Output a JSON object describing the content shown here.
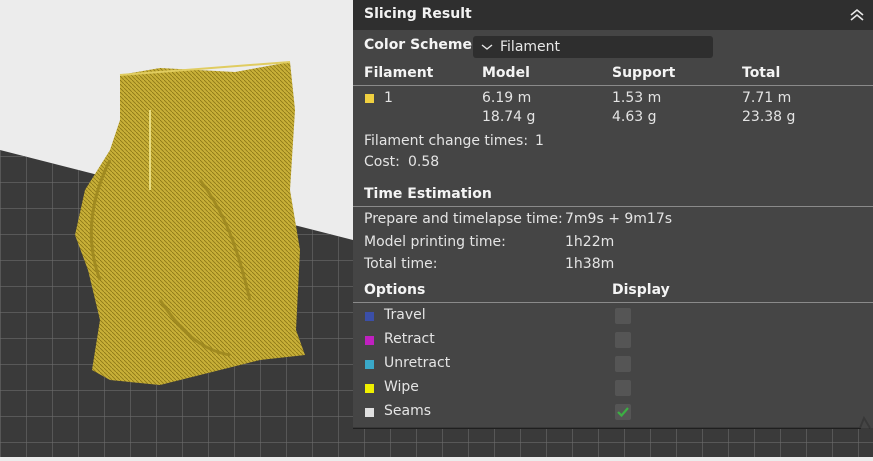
{
  "panel": {
    "title": "Slicing Result",
    "color_scheme_label": "Color Scheme",
    "color_scheme_value": "Filament",
    "filament_table": {
      "headers": [
        "Filament",
        "Model",
        "Support",
        "Total"
      ],
      "row": {
        "id": "1",
        "swatch_color": "#f0d040",
        "model_length": "6.19 m",
        "model_weight": "18.74 g",
        "support_length": "1.53 m",
        "support_weight": "4.63 g",
        "total_length": "7.71 m",
        "total_weight": "23.38 g"
      }
    },
    "filament_change_label": "Filament change times:",
    "filament_change_value": "1",
    "cost_label": "Cost:",
    "cost_value": "0.58",
    "time_heading": "Time Estimation",
    "time_rows": [
      {
        "label": "Prepare and timelapse time:",
        "value": "7m9s + 9m17s"
      },
      {
        "label": "Model printing time:",
        "value": "1h22m"
      },
      {
        "label": "Total time:",
        "value": "1h38m"
      }
    ],
    "options_header": "Options",
    "display_header": "Display",
    "options": [
      {
        "label": "Travel",
        "color": "#3b4fa8",
        "checked": false
      },
      {
        "label": "Retract",
        "color": "#c020c0",
        "checked": false
      },
      {
        "label": "Unretract",
        "color": "#3aa8c8",
        "checked": false
      },
      {
        "label": "Wipe",
        "color": "#f0f000",
        "checked": false
      },
      {
        "label": "Seams",
        "color": "#e0e0e0",
        "checked": true
      }
    ],
    "check_color": "#3cb043"
  },
  "viewport": {
    "model_color": "#c8b038",
    "bed_color": "#3a3a3a"
  }
}
